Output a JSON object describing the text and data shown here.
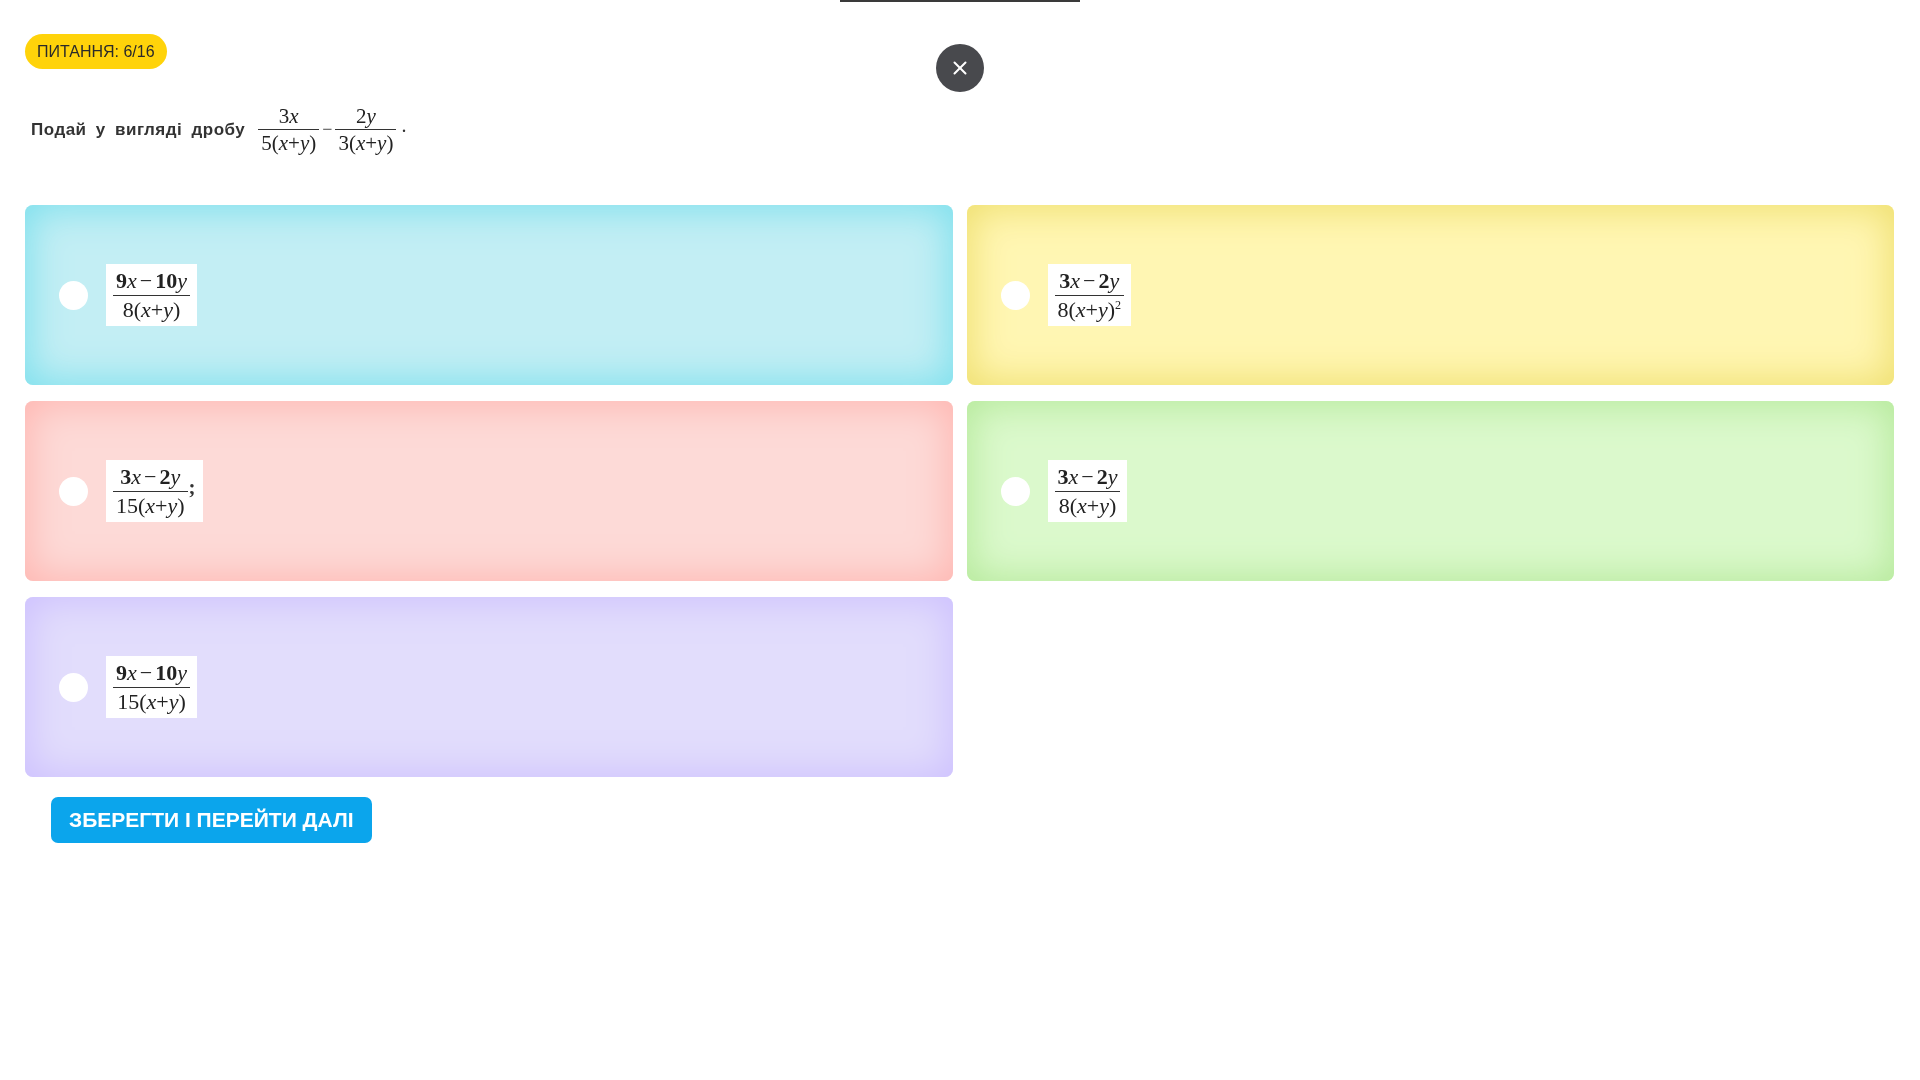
{
  "badge": "ПИТАННЯ: 6/16",
  "question": {
    "text": "Подай у вигляді дробу",
    "expression": [
      {
        "kind": "fraction",
        "numerator": [
          {
            "kind": "number",
            "text": "3"
          },
          {
            "kind": "variable",
            "text": "x"
          }
        ],
        "denominator": "5(*x*+*y*)"
      },
      {
        "kind": "operator",
        "text": "−"
      },
      {
        "kind": "fraction",
        "numerator": [
          {
            "kind": "number",
            "text": "2"
          },
          {
            "kind": "variable",
            "text": "y"
          }
        ],
        "denominator": "3(*x*+*y*)"
      },
      {
        "kind": "punctuation",
        "text": "."
      }
    ]
  },
  "options": [
    {
      "numerator": [
        {
          "kind": "number",
          "text": "9"
        },
        {
          "kind": "variable",
          "text": "x"
        },
        {
          "kind": "sign",
          "text": "−"
        },
        {
          "kind": "number",
          "text": "10"
        },
        {
          "kind": "variable",
          "text": "y"
        }
      ],
      "denominator": "8(*x*+*y*)",
      "color": "#c3eef4",
      "selected": false
    },
    {
      "numerator": [
        {
          "kind": "number",
          "text": "3"
        },
        {
          "kind": "variable",
          "text": "x"
        },
        {
          "kind": "sign",
          "text": "−"
        },
        {
          "kind": "number",
          "text": "2"
        },
        {
          "kind": "variable",
          "text": "y"
        }
      ],
      "denominator": "8(*x*+*y*)$^{2}$",
      "color": "#fff6b3",
      "selected": false
    },
    {
      "numerator": [
        {
          "kind": "number",
          "text": "3"
        },
        {
          "kind": "variable",
          "text": "x"
        },
        {
          "kind": "sign",
          "text": "−"
        },
        {
          "kind": "number",
          "text": "2"
        },
        {
          "kind": "variable",
          "text": "y"
        }
      ],
      "denominator": "15(*x*+*y*)",
      "suffix": ";",
      "color": "#fddad7",
      "selected": false
    },
    {
      "numerator": [
        {
          "kind": "number",
          "text": "3"
        },
        {
          "kind": "variable",
          "text": "x"
        },
        {
          "kind": "sign",
          "text": "−"
        },
        {
          "kind": "number",
          "text": "2"
        },
        {
          "kind": "variable",
          "text": "y"
        }
      ],
      "denominator": "8(*x*+*y*)",
      "color": "#dbf9cc",
      "selected": false
    },
    {
      "numerator": [
        {
          "kind": "number",
          "text": "9"
        },
        {
          "kind": "variable",
          "text": "x"
        },
        {
          "kind": "sign",
          "text": "−"
        },
        {
          "kind": "number",
          "text": "10"
        },
        {
          "kind": "variable",
          "text": "y"
        }
      ],
      "denominator": "15(*x*+*y*)",
      "color": "#e2ddfc",
      "selected": false
    }
  ],
  "submit_button": "ЗБЕРЕГТИ І ПЕРЕЙТИ ДАЛІ"
}
